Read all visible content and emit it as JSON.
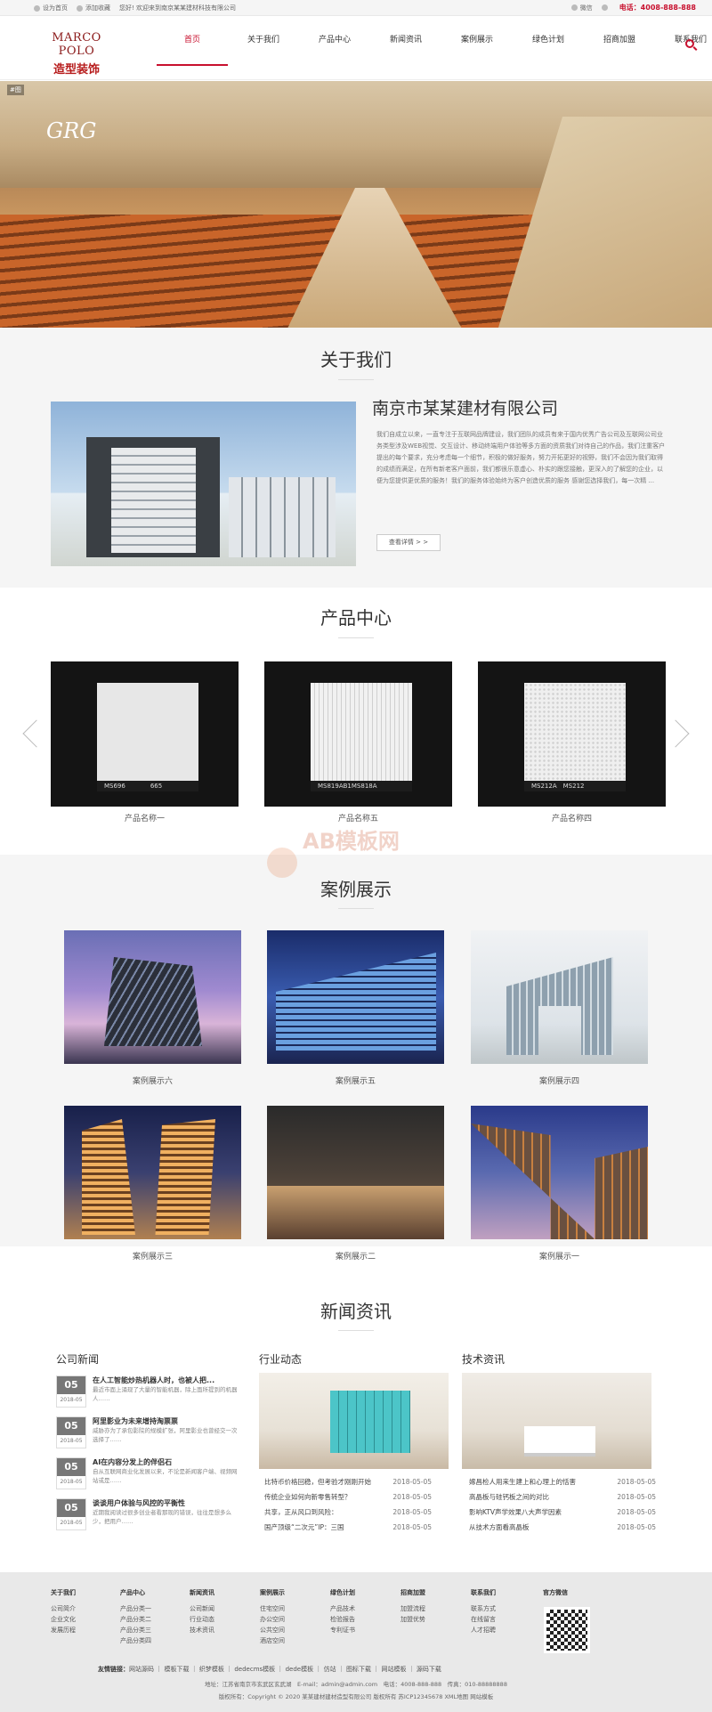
{
  "topbar": {
    "home": "设为首页",
    "fav": "添加收藏",
    "welcome": "您好! 欢迎来到南京某某建材科技有限公司",
    "wechat": "微信",
    "weibo": "",
    "phone": "电话：4008-888-888"
  },
  "logo": {
    "line1": "MARCO POLO",
    "line2": "造型装饰"
  },
  "nav": [
    "首页",
    "关于我们",
    "产品中心",
    "新闻资讯",
    "案例展示",
    "绿色计划",
    "招商加盟",
    "联系我们"
  ],
  "banner": {
    "tag": "#图",
    "text": "GRG"
  },
  "about": {
    "title": "关于我们",
    "company": "南京市某某建材有限公司",
    "desc": "我们自成立以来，一直专注于互联网品牌建设，我们团队的成员有来于国内优秀广告公司及互联网公司业务类型涉及WEB视觉、交互设计、移动终端用户体验等多方面的资质我们对待自己的作品，我们注重客户提出的每个要求，充分考虑每一个细节，积极的做好服务，努力开拓更好的视野，我们不会因为我们取得的成绩而满足，在所有新老客户面前，我们都很乐意虚心、朴实的跟您接触，更深入的了解您的企业，以便为您提供更优质的服务！我们的服务体验始终为客户创造优质的服务 感谢您选择我们，每一次精 ...",
    "more": "查看详情 > >"
  },
  "products": {
    "title": "产品中心",
    "items": [
      {
        "name": "产品名称一",
        "code": "MS696　　　　665"
      },
      {
        "name": "产品名称五",
        "code": "MS819AB1MS818A"
      },
      {
        "name": "产品名称四",
        "code": "MS212A　MS212"
      }
    ]
  },
  "watermark": "AB模板网",
  "cases": {
    "title": "案例展示",
    "items": [
      "案例展示六",
      "案例展示五",
      "案例展示四",
      "案例展示三",
      "案例展示二",
      "案例展示一"
    ]
  },
  "news": {
    "title": "新闻资讯",
    "col1": {
      "title": "公司新闻",
      "items": [
        {
          "day": "05",
          "year": "2018-05",
          "title": "在人工智能炒热机器人时，也被人把...",
          "summary": "最近市面上涌现了大量的智能机器，除上面所提到的机器人……"
        },
        {
          "day": "05",
          "year": "2018-05",
          "title": "阿里影业为未来增持淘票票",
          "summary": "威胁亦为了承包影院的规模扩张，阿里影业也曾经交一次选择了……"
        },
        {
          "day": "05",
          "year": "2018-05",
          "title": "AI在内容分发上的伴侣石",
          "summary": "自从互联网商业化发展以来，不论是新闻客户端、视频网站或是……"
        },
        {
          "day": "05",
          "year": "2018-05",
          "title": "谈谈用户体验与风控的平衡性",
          "summary": "近期我阅读过很多创业者看那现的错误，往往是想多么少，把用户……"
        }
      ]
    },
    "col2": {
      "title": "行业动态",
      "items": [
        {
          "title": "比特币价格回稳，但考验才刚刚开始",
          "date": "2018-05-05"
        },
        {
          "title": "传统企业如何向新零售转型？",
          "date": "2018-05-05"
        },
        {
          "title": "共享，正从风口到风险：",
          "date": "2018-05-05"
        },
        {
          "title": "国产顶级“二次元”IP：三国",
          "date": "2018-05-05"
        }
      ]
    },
    "col3": {
      "title": "技术资讯",
      "items": [
        {
          "title": "嫁昌检人用来生建上和心理上的恬害",
          "date": "2018-05-05"
        },
        {
          "title": "高晶板与硅钙板之间的对比",
          "date": "2018-05-05"
        },
        {
          "title": "影响KTV声学效果八大声学因素",
          "date": "2018-05-05"
        },
        {
          "title": "从技术方面看高晶板",
          "date": "2018-05-05"
        }
      ]
    }
  },
  "footer": {
    "cols": [
      {
        "title": "关于我们",
        "items": [
          "公司简介",
          "企业文化",
          "发展历程"
        ]
      },
      {
        "title": "产品中心",
        "items": [
          "产品分类一",
          "产品分类二",
          "产品分类三",
          "产品分类四"
        ]
      },
      {
        "title": "新闻资讯",
        "items": [
          "公司新闻",
          "行业动态",
          "技术资讯"
        ]
      },
      {
        "title": "案例展示",
        "items": [
          "住宅空间",
          "办公空间",
          "公共空间",
          "酒店空间"
        ]
      },
      {
        "title": "绿色计划",
        "items": [
          "产品技术",
          "检验报告",
          "专利证书"
        ]
      },
      {
        "title": "招商加盟",
        "items": [
          "加盟流程",
          "加盟优势"
        ]
      },
      {
        "title": "联系我们",
        "items": [
          "联系方式",
          "在线留言",
          "人才招聘"
        ]
      },
      {
        "title": "官方微信",
        "items": []
      }
    ],
    "links_label": "友情链接：",
    "links": "网站源码 ｜ 模板下载 ｜ 织梦模板 ｜ dedecms模板 ｜ dede模板 ｜ 仿站 ｜ 图标下载 ｜ 网站模板 ｜ 源码下载",
    "address": "地址：江苏省南京市玄武区玄武湖　E-mail：admin@admin.com　电话：4008-888-888　传真：010-88888888",
    "copyright": "版权所有：Copyright © 2020 某某建材建材造型有限公司 版权所有 苏ICP12345678 XML地图 网站模板"
  }
}
